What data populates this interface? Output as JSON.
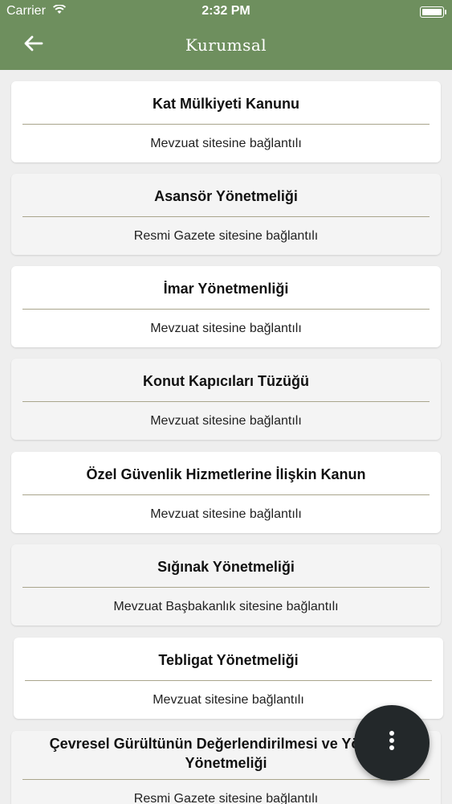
{
  "status_bar": {
    "carrier": "Carrier",
    "wifi_icon": "wifi-icon",
    "time": "2:32 PM",
    "battery_icon": "battery-icon"
  },
  "nav_bar": {
    "back_icon": "arrow-left-icon",
    "back_glyph": "←",
    "title": "Kurumsal",
    "color": "#6e8f5e"
  },
  "items": [
    {
      "title": "Kat Mülkiyeti Kanunu",
      "subtitle": "Mevzuat sitesine bağlantılı"
    },
    {
      "title": "Asansör Yönetmeliği",
      "subtitle": "Resmi Gazete sitesine bağlantılı"
    },
    {
      "title": "İmar Yönetmenliği",
      "subtitle": "Mevzuat sitesine bağlantılı"
    },
    {
      "title": "Konut Kapıcıları Tüzüğü",
      "subtitle": "Mevzuat sitesine bağlantılı"
    },
    {
      "title": "Özel Güvenlik Hizmetlerine İlişkin Kanun",
      "subtitle": "Mevzuat sitesine bağlantılı"
    },
    {
      "title": "Sığınak Yönetmeliği",
      "subtitle": "Mevzuat Başbakanlık sitesine bağlantılı"
    },
    {
      "title": "Tebligat Yönetmeliği",
      "subtitle": "Mevzuat sitesine bağlantılı"
    },
    {
      "title": "Çevresel Gürültünün Değerlendirilmesi ve Yönetimi Yönetmeliği",
      "subtitle": "Resmi Gazete sitesine bağlantılı"
    }
  ],
  "fab": {
    "icon": "more-vertical-icon"
  }
}
